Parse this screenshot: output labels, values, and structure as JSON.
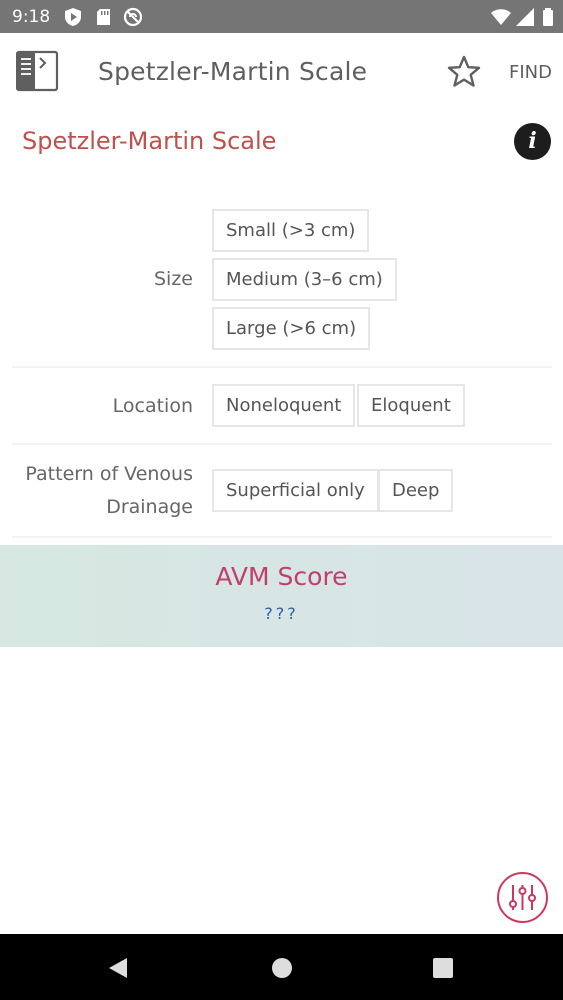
{
  "status_bar": {
    "time": "9:18",
    "left_icons": [
      "shield-play-icon",
      "sd-card-icon",
      "no-sync-icon"
    ],
    "right_icons": [
      "wifi-icon",
      "signal-icon",
      "battery-icon"
    ]
  },
  "app_bar": {
    "menu_icon": "book-sidebar-icon",
    "title": "Spetzler-Martin Scale",
    "star_icon": "star-outline-icon",
    "find_label": "FIND"
  },
  "calculator": {
    "title": "Spetzler-Martin Scale",
    "info_glyph": "i",
    "rows": [
      {
        "label": "Size",
        "options": [
          "Small (>3 cm)",
          "Medium (3–6 cm)",
          "Large (>6 cm)"
        ]
      },
      {
        "label": "Location",
        "options": [
          "Noneloquent",
          "Eloquent"
        ]
      },
      {
        "label_lines": [
          "Pattern of Venous",
          "Drainage"
        ],
        "options": [
          "Superficial only",
          "Deep"
        ]
      }
    ]
  },
  "result": {
    "title": "AVM Score",
    "value": "???"
  },
  "fab": {
    "icon": "sliders-icon"
  },
  "colors": {
    "status_bar": "#757575",
    "title_accent": "#c0504d",
    "score_title": "#c0406a",
    "score_value": "#2a5fa0",
    "fab_accent": "#d2365f"
  },
  "nav_bar": {
    "icons": [
      "back-triangle-icon",
      "home-circle-icon",
      "recents-square-icon"
    ]
  }
}
